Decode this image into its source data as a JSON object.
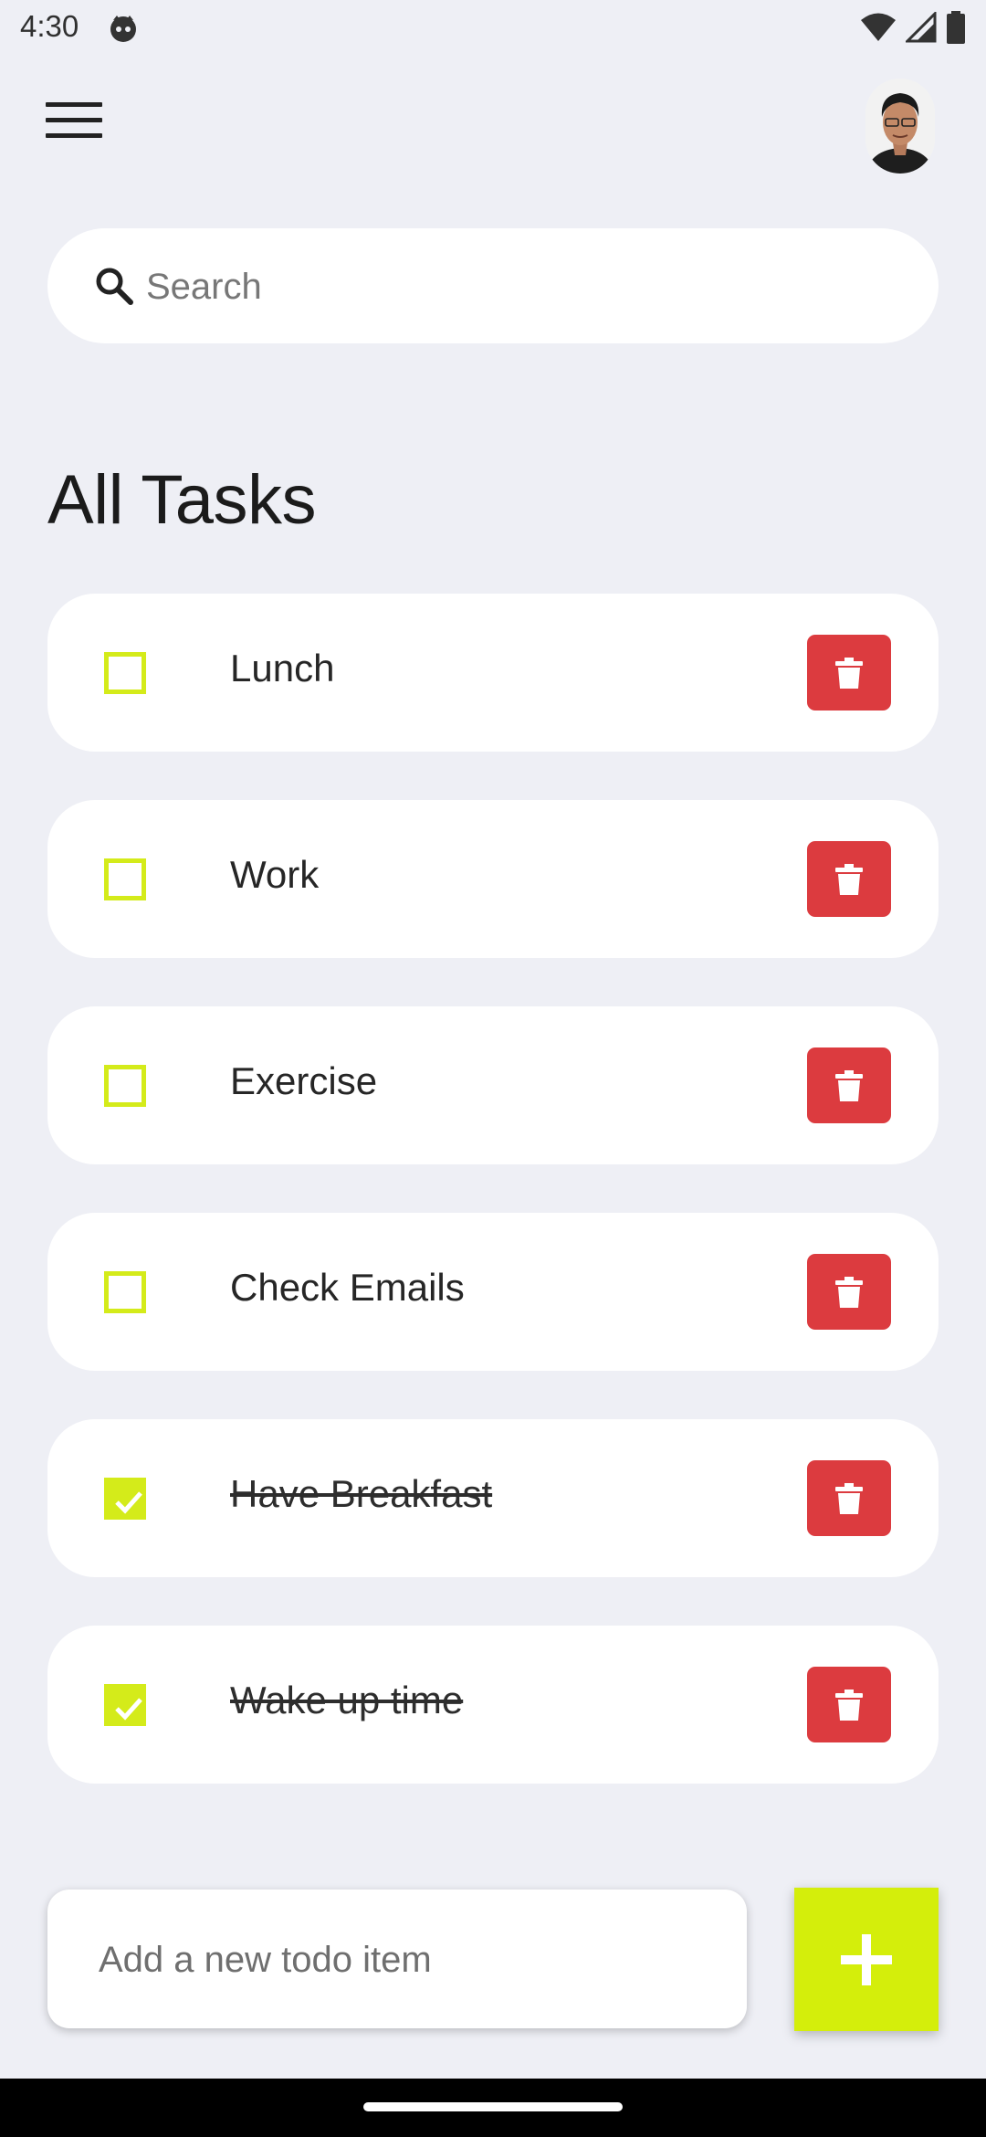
{
  "status_bar": {
    "time": "4:30"
  },
  "app_bar": {
    "menu_icon": "hamburger-menu",
    "avatar": "user-avatar"
  },
  "search": {
    "placeholder": "Search",
    "value": ""
  },
  "page": {
    "title": "All Tasks"
  },
  "tasks": [
    {
      "label": "Lunch",
      "done": false
    },
    {
      "label": "Work",
      "done": false
    },
    {
      "label": "Exercise",
      "done": false
    },
    {
      "label": "Check Emails",
      "done": false
    },
    {
      "label": "Have Breakfast",
      "done": true
    },
    {
      "label": "Wake up time",
      "done": true
    }
  ],
  "add_todo": {
    "placeholder": "Add a new todo item",
    "value": "",
    "button_icon": "plus-icon"
  },
  "colors": {
    "background": "#EEEFF5",
    "accent": "#D4EB1A",
    "delete": "#DC3B3F",
    "card": "#FFFFFF"
  }
}
